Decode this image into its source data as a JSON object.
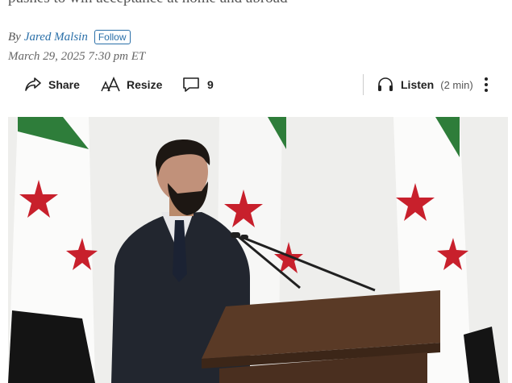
{
  "article": {
    "dek": "pushes to win acceptance at home and abroad",
    "byline_prefix": "By",
    "author": "Jared Malsin",
    "follow_label": "Follow",
    "date": "March 29, 2025 7:30 pm ET"
  },
  "toolbar": {
    "share_label": "Share",
    "resize_label": "Resize",
    "comment_count": "9",
    "listen_label": "Listen",
    "listen_duration": "(2 min)"
  },
  "icons": {
    "share": "share-icon",
    "resize": "text-resize-icon",
    "comments": "comment-icon",
    "listen": "headphones-icon",
    "more": "more-vertical-icon"
  },
  "colors": {
    "link": "#2a6fa8",
    "flag_green": "#2e7d3a",
    "flag_red": "#c8202c",
    "flag_black": "#111111"
  }
}
